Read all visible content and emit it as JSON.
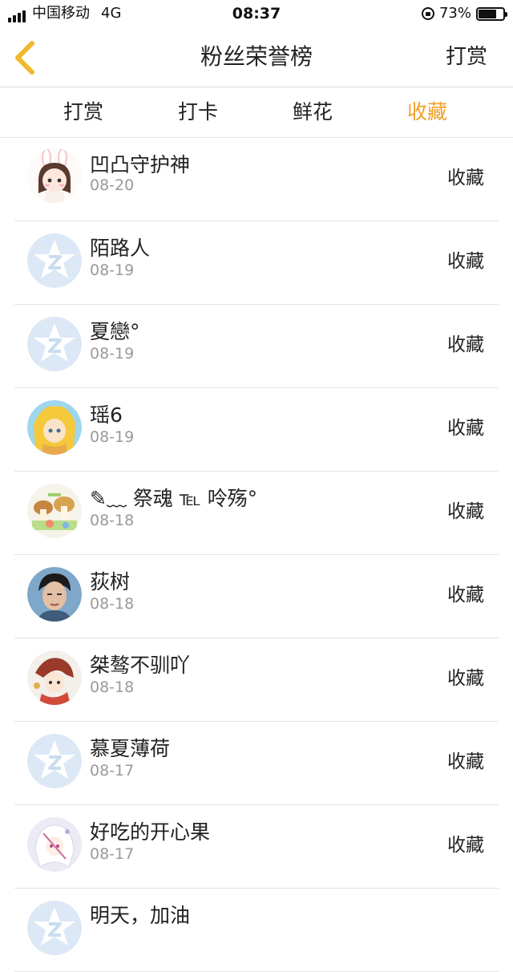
{
  "status_bar": {
    "carrier": "中国移动",
    "network": "4G",
    "time": "08:37",
    "battery_text": "73%",
    "battery_level": 0.73
  },
  "nav": {
    "title": "粉丝荣誉榜",
    "right_label": "打赏",
    "back_icon": "chevron-left-icon",
    "back_color": "#f0b82c"
  },
  "tabs": [
    {
      "label": "打赏"
    },
    {
      "label": "打卡"
    },
    {
      "label": "鲜花"
    },
    {
      "label": "收藏",
      "active": true
    }
  ],
  "accent_color": "#f0a028",
  "list": [
    {
      "name": "凹凸守护神",
      "date": "08-20",
      "action": "收藏",
      "avatar": "girl-bunny"
    },
    {
      "name": "陌路人",
      "date": "08-19",
      "action": "收藏",
      "avatar": "default-q"
    },
    {
      "name": "夏戀°",
      "date": "08-19",
      "action": "收藏",
      "avatar": "default-q"
    },
    {
      "name": "瑶6",
      "date": "08-19",
      "action": "收藏",
      "avatar": "anime-yellow"
    },
    {
      "name": "✎﹏ 祭魂 ℡ 呤殇°",
      "date": "08-18",
      "action": "收藏",
      "avatar": "cartoon-scene"
    },
    {
      "name": "荻树",
      "date": "08-18",
      "action": "收藏",
      "avatar": "photo-boy"
    },
    {
      "name": "桀骜不驯吖",
      "date": "08-18",
      "action": "收藏",
      "avatar": "anime-red"
    },
    {
      "name": "慕夏薄荷",
      "date": "08-17",
      "action": "收藏",
      "avatar": "default-q"
    },
    {
      "name": "好吃的开心果",
      "date": "08-17",
      "action": "收藏",
      "avatar": "anime-white"
    },
    {
      "name": "明天，加油",
      "date": "",
      "action": "",
      "avatar": "default-q"
    }
  ]
}
